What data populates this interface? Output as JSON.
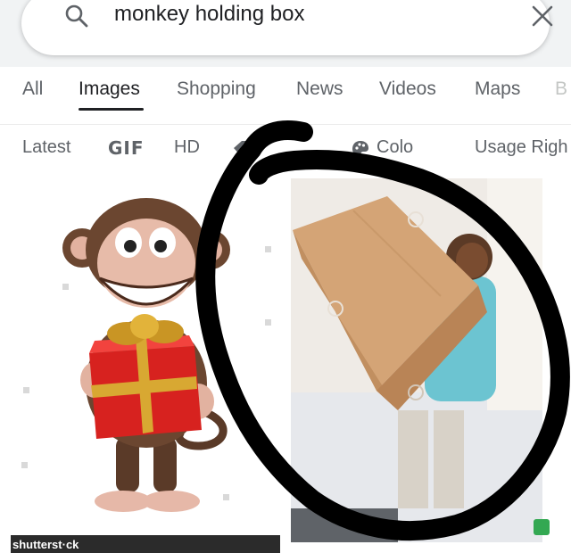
{
  "search": {
    "query": "monkey holding box"
  },
  "tabs": [
    {
      "label": "All"
    },
    {
      "label": "Images"
    },
    {
      "label": "Shopping"
    },
    {
      "label": "News"
    },
    {
      "label": "Videos"
    },
    {
      "label": "Maps"
    },
    {
      "label": "B"
    }
  ],
  "filters": [
    {
      "label": "Latest"
    },
    {
      "label": "GIF"
    },
    {
      "label": "HD"
    },
    {
      "label": "Colo"
    },
    {
      "label": "Usage Righ"
    }
  ],
  "results": {
    "watermark_left": "shutterst·ck"
  },
  "icons": {
    "search": "search-icon",
    "close": "close-icon",
    "tag": "tag-icon",
    "palette": "palette-icon"
  }
}
